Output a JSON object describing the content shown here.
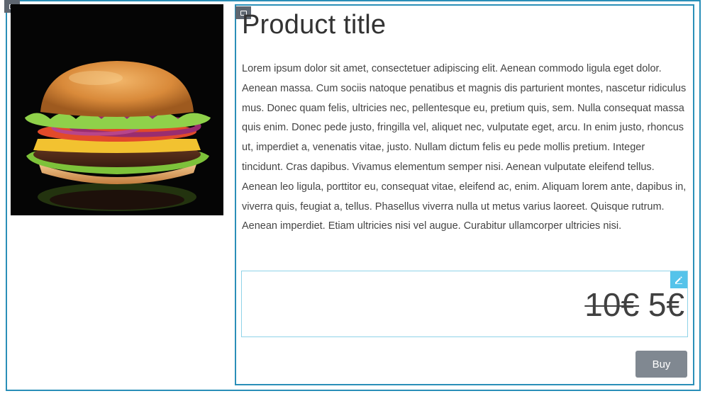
{
  "product": {
    "title": "Product title",
    "description": "Lorem ipsum dolor sit amet, consectetuer adipiscing elit. Aenean commodo ligula eget dolor. Aenean massa. Cum sociis natoque penatibus et magnis dis parturient montes, nascetur ridiculus mus. Donec quam felis, ultricies nec, pellentesque eu, pretium quis, sem. Nulla consequat massa quis enim. Donec pede justo, fringilla vel, aliquet nec, vulputate eget, arcu. In enim justo, rhoncus ut, imperdiet a, venenatis vitae, justo. Nullam dictum felis eu pede mollis pretium. Integer tincidunt. Cras dapibus. Vivamus elementum semper nisi. Aenean vulputate eleifend tellus. Aenean leo ligula, porttitor eu, consequat vitae, eleifend ac, enim. Aliquam lorem ante, dapibus in, viverra quis, feugiat a, tellus. Phasellus viverra nulla ut metus varius laoreet. Quisque rutrum. Aenean imperdiet. Etiam ultricies nisi vel augue. Curabitur ullamcorper ultricies nisi.",
    "image_icon": "hamburger-photo",
    "price_old": "10€",
    "price_new": "5€",
    "buy_label": "Buy"
  },
  "editor": {
    "block_tag_icon": "block-rect-icon",
    "edit_icon": "pencil-icon"
  },
  "colors": {
    "frame_border": "#2a8fb8",
    "edit_badge": "#55c3ea",
    "button_bg": "#808891",
    "tag_bg": "#5e6670"
  }
}
